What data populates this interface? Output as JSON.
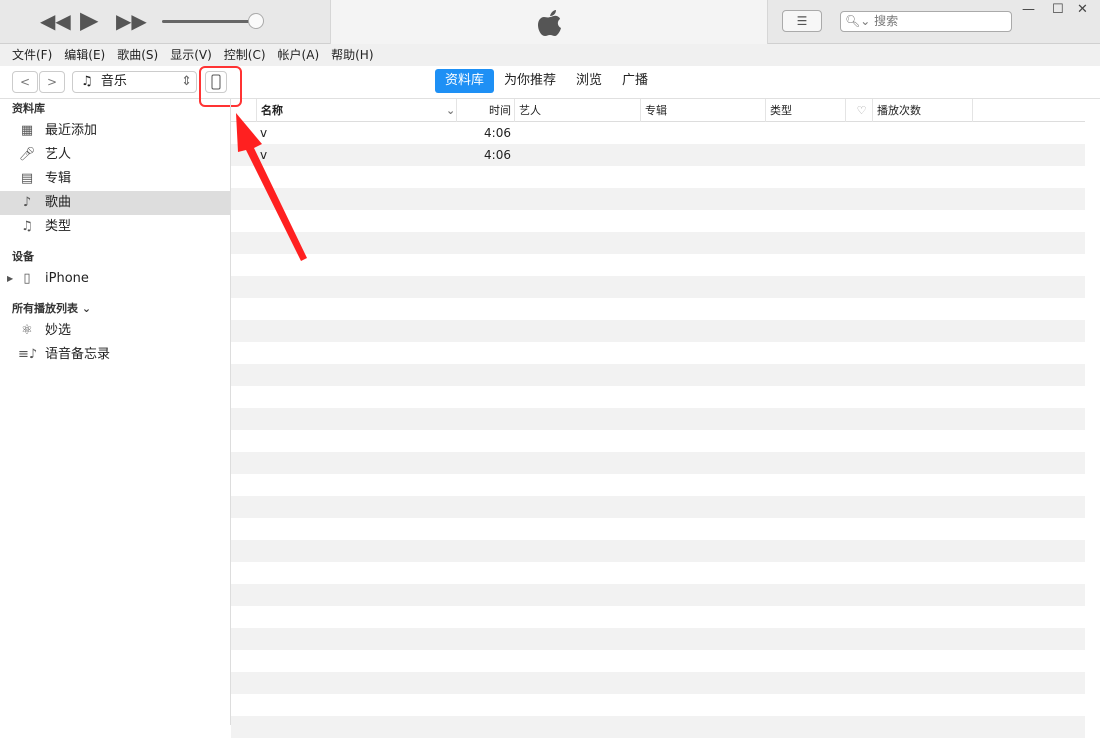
{
  "player": {
    "prev": "◀◀",
    "play": "▶",
    "next": "▶▶",
    "volume": 0.95,
    "logo": "apple-logo"
  },
  "search": {
    "placeholder": "搜索"
  },
  "window": {
    "minimize": "—",
    "maximize": "☐",
    "close": "✕"
  },
  "menu": [
    "文件(F)",
    "编辑(E)",
    "歌曲(S)",
    "显示(V)",
    "控制(C)",
    "帐户(A)",
    "帮助(H)"
  ],
  "toolbar": {
    "back": "<",
    "forward": ">",
    "media": "音乐",
    "tabs": [
      "资料库",
      "为你推荐",
      "浏览",
      "广播"
    ],
    "active_tab": 0
  },
  "sidebar": {
    "library_header": "资料库",
    "library": [
      {
        "label": "最近添加",
        "icon": "grid-icon"
      },
      {
        "label": "艺人",
        "icon": "microphone-icon"
      },
      {
        "label": "专辑",
        "icon": "album-icon"
      },
      {
        "label": "歌曲",
        "icon": "note-icon",
        "selected": true
      },
      {
        "label": "类型",
        "icon": "genre-icon"
      }
    ],
    "devices_header": "设备",
    "devices": [
      {
        "label": "iPhone"
      }
    ],
    "playlists_header": "所有播放列表",
    "playlists": [
      {
        "label": "妙选",
        "icon": "atom-icon"
      },
      {
        "label": "语音备忘录",
        "icon": "playlist-icon"
      }
    ]
  },
  "table": {
    "columns": [
      "名称",
      "时间",
      "艺人",
      "专辑",
      "类型",
      "♡",
      "播放次数"
    ],
    "rows": [
      {
        "name": "v",
        "time": "4:06"
      },
      {
        "name": "v",
        "time": "4:06"
      }
    ]
  },
  "annotation": {
    "color": "#ff2020"
  }
}
